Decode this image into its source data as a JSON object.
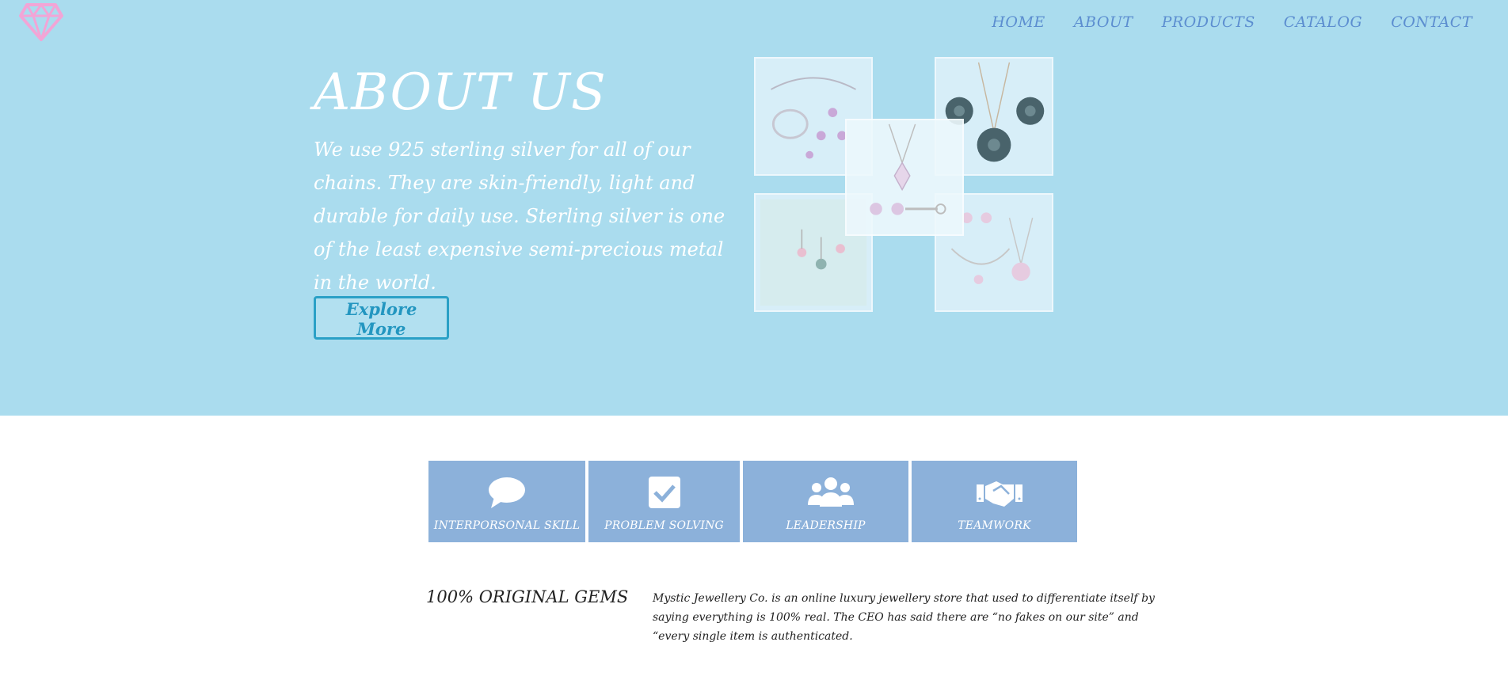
{
  "nav": {
    "items": [
      "HOME",
      "ABOUT",
      "PRODUCTS",
      "CATALOG",
      "CONTACT"
    ]
  },
  "hero": {
    "title": "ABOUT US",
    "text": "We use 925 sterling silver for all of our chains. They are skin-friendly, light and durable for daily use. Sterling silver is one of the least expensive semi-precious metal in the world.",
    "button_label": "Explore More"
  },
  "skills": [
    {
      "label": "INTERPORSONAL SKILL",
      "icon": "speech-bubble-icon"
    },
    {
      "label": "PROBLEM SOLVING",
      "icon": "checkbox-icon"
    },
    {
      "label": "LEADERSHIP",
      "icon": "users-icon"
    },
    {
      "label": "TEAMWORK",
      "icon": "handshake-icon"
    }
  ],
  "gems": {
    "title": "100% ORIGINAL GEMS",
    "text": "Mystic Jewellery Co. is an online luxury jewellery store that used to differentiate itself by saying everything is 100% real. The CEO has said there are “no fakes on our site” and “every single item is authenticated."
  },
  "colors": {
    "hero_bg": "#aadcee",
    "nav": "#5c8ed0",
    "skill_tile": "#8cb1da",
    "logo": "#f2a5d6",
    "button_border": "#2aa0c6"
  }
}
